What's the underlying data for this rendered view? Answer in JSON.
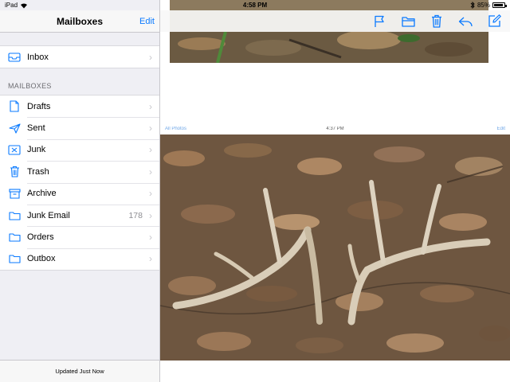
{
  "status": {
    "carrier": "iPad",
    "time": "4:58 PM",
    "battery": "85%"
  },
  "sidebar": {
    "title": "Mailboxes",
    "edit_label": "Edit",
    "inbox": {
      "label": "Inbox",
      "icon": "inbox-icon"
    },
    "section_header": "MAILBOXES",
    "items": [
      {
        "label": "Drafts",
        "icon": "document-icon",
        "count": ""
      },
      {
        "label": "Sent",
        "icon": "paper-plane-icon",
        "count": ""
      },
      {
        "label": "Junk",
        "icon": "junk-tray-icon",
        "count": ""
      },
      {
        "label": "Trash",
        "icon": "trash-icon",
        "count": ""
      },
      {
        "label": "Archive",
        "icon": "archive-box-icon",
        "count": ""
      },
      {
        "label": "Junk Email",
        "icon": "folder-icon",
        "count": "178"
      },
      {
        "label": "Orders",
        "icon": "folder-icon",
        "count": ""
      },
      {
        "label": "Outbox",
        "icon": "folder-icon",
        "count": ""
      }
    ],
    "footer": "Updated Just Now"
  },
  "toolbar": {
    "actions": [
      "flag-icon",
      "folder-icon",
      "trash-icon",
      "reply-icon",
      "compose-icon"
    ]
  },
  "embedded_screenshot": {
    "back_label": "All Photos",
    "time": "4:37 PM",
    "edit_label": "Edit"
  },
  "colors": {
    "accent": "#0a7aff",
    "sidebar_bg": "#efeff4",
    "separator": "#c8c7cc"
  }
}
